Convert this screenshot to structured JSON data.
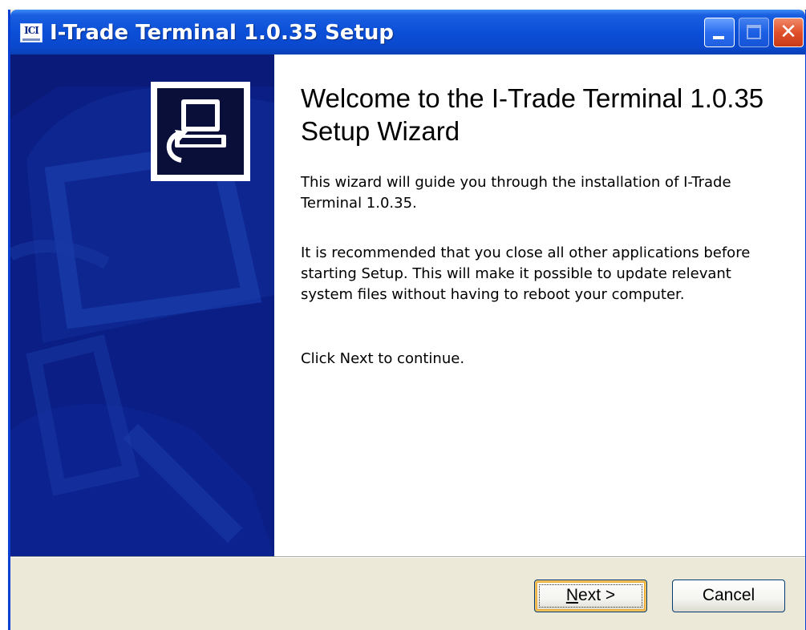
{
  "window": {
    "title": "I-Trade Terminal 1.0.35 Setup",
    "app_icon_text": "ICI"
  },
  "titlebar_buttons": {
    "minimize": "minimize-icon",
    "maximize": "maximize-icon",
    "close": "close-icon"
  },
  "welcome": {
    "heading": "Welcome to the I-Trade Terminal 1.0.35 Setup Wizard",
    "paragraph_1": "This wizard will guide you through the installation of I-Trade Terminal 1.0.35.",
    "paragraph_2": "It is recommended that you close all other applications before starting Setup. This will make it possible to update relevant system files without having to reboot your computer.",
    "paragraph_3": "Click Next to continue."
  },
  "buttons": {
    "next_mnemonic": "N",
    "next_rest": "ext >",
    "cancel": "Cancel"
  },
  "colors": {
    "titlebar": "#0b4fd8",
    "side_panel": "#0a1a78",
    "dialog_face": "#ece9d8"
  }
}
